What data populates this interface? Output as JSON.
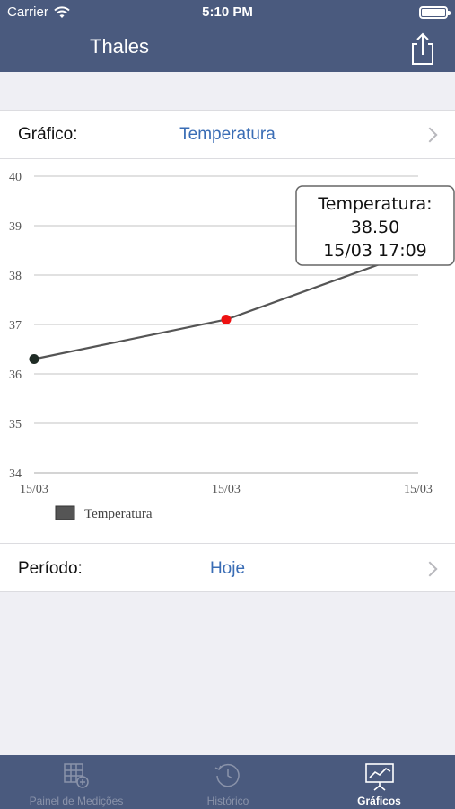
{
  "status_bar": {
    "carrier": "Carrier",
    "time": "5:10 PM"
  },
  "nav": {
    "title": "Thales"
  },
  "grafico_row": {
    "label": "Gráfico:",
    "value": "Temperatura"
  },
  "periodo_row": {
    "label": "Período:",
    "value": "Hoje"
  },
  "tabs": [
    {
      "label": "Painel de Medições",
      "icon": "grid-plus-icon",
      "selected": false
    },
    {
      "label": "Histórico",
      "icon": "clock-icon",
      "selected": false
    },
    {
      "label": "Gráficos",
      "icon": "presentation-chart-icon",
      "selected": true
    }
  ],
  "chart_data": {
    "type": "line",
    "categories": [
      "15/03",
      "15/03",
      "15/03"
    ],
    "series": [
      {
        "name": "Temperatura",
        "values": [
          36.3,
          37.1,
          38.5
        ]
      }
    ],
    "y_ticks": [
      34,
      35,
      36,
      37,
      38,
      39,
      40
    ],
    "x_ticks": [
      "15/03",
      "15/03",
      "15/03"
    ],
    "ylim": [
      34,
      40
    ],
    "grid": true,
    "legend": "bottom-left",
    "highlight_index": 1,
    "tooltip": {
      "title": "Temperatura:",
      "value": "38.50",
      "time": "15/03 17:09"
    },
    "colors": {
      "line": "#555555",
      "first_point": "#1f2b25",
      "highlight_point": "#ee1111",
      "legend_swatch": "#555555"
    }
  }
}
